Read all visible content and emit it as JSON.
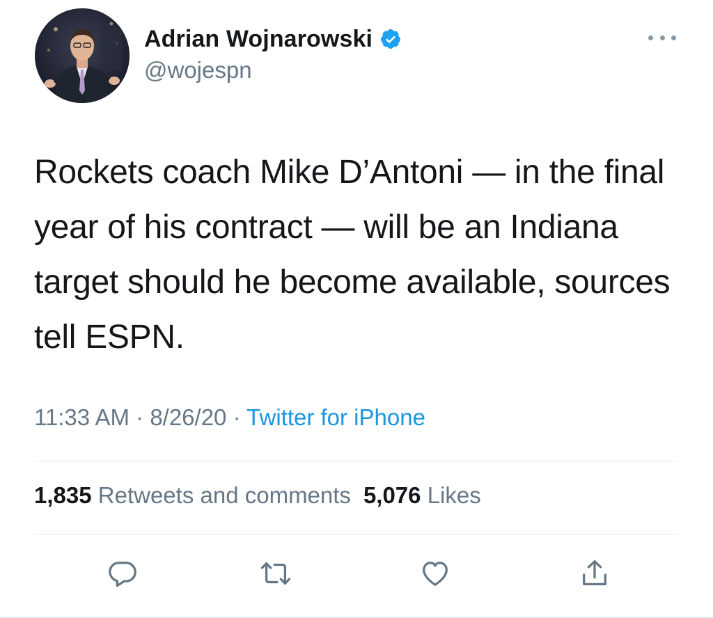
{
  "author": {
    "display_name": "Adrian Wojnarowski",
    "handle": "@wojespn",
    "verified": true,
    "avatar_icon": "profile-photo"
  },
  "menu_icon": "more-horizontal-icon",
  "tweet": {
    "text": "Rockets coach Mike D’Antoni — in the final year of his contract — will be an Indiana target should he become available, sources tell ESPN.",
    "time": "11:33 AM",
    "separator": " · ",
    "date": "8/26/20",
    "source": "Twitter for iPhone"
  },
  "stats": {
    "retweets_count": "1,835",
    "retweets_label": "Retweets and comments",
    "likes_count": "5,076",
    "likes_label": "Likes"
  },
  "actions": [
    {
      "icon": "reply-icon"
    },
    {
      "icon": "retweet-icon"
    },
    {
      "icon": "like-icon"
    },
    {
      "icon": "share-icon"
    }
  ],
  "colors": {
    "verified_blue": "#1da1f2",
    "link_blue": "#1b95e0",
    "secondary_gray": "#657786",
    "text": "#14171a",
    "divider": "#e1e8ed"
  }
}
